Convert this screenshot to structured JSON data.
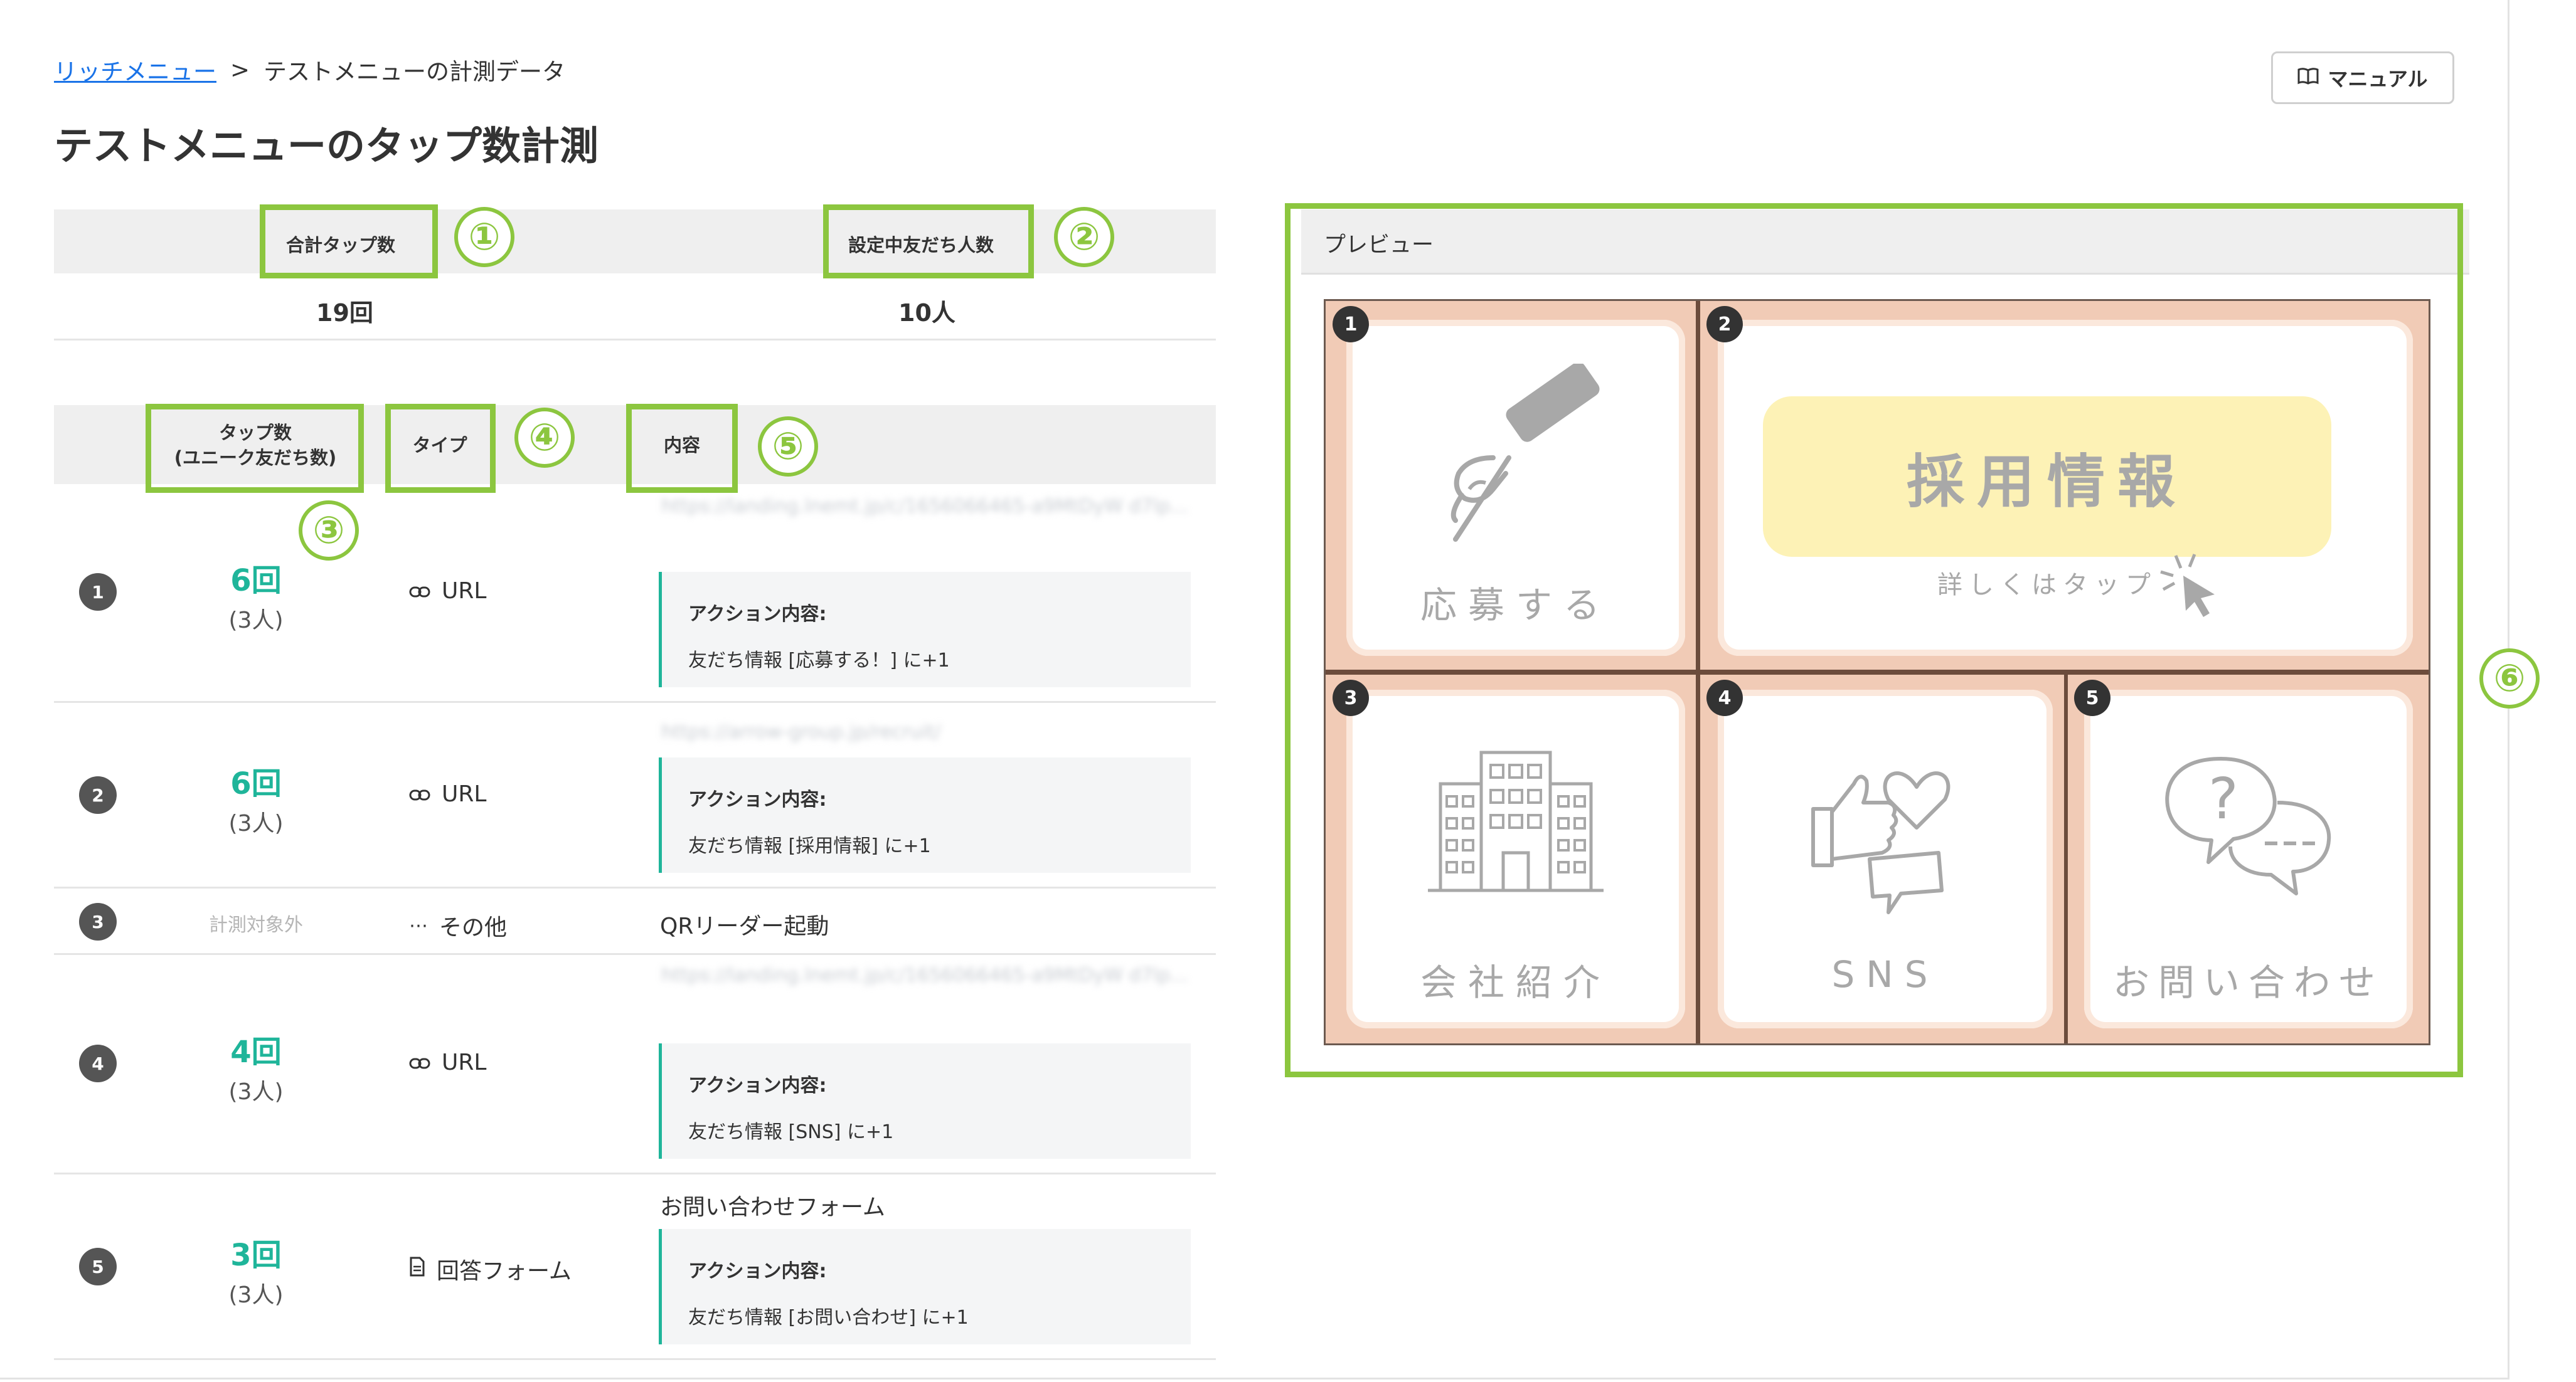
{
  "breadcrumb": {
    "parent": "リッチメニュー",
    "separator": ">",
    "current": "テストメニューの計測データ"
  },
  "page_title": "テストメニューのタップ数計測",
  "manual_button": "マニュアル",
  "summary": {
    "total_taps_label": "合計タップ数",
    "total_taps_value": "19回",
    "friends_label": "設定中友だち人数",
    "friends_value": "10人"
  },
  "table": {
    "headers": {
      "taps_line1": "タップ数",
      "taps_line2": "(ユニーク友だち数)",
      "type": "タイプ",
      "content": "内容"
    },
    "rows": [
      {
        "num": "1",
        "count": "6回",
        "people": "(3人)",
        "type": "URL",
        "url": "https://landing.lnemt.jp/c/1656066465-a9MtDyW d7lp...",
        "action_title": "アクション内容:",
        "action_detail": "友だち情報 [応募する！] に+1"
      },
      {
        "num": "2",
        "count": "6回",
        "people": "(3人)",
        "type": "URL",
        "url": "https://arrow-group.jp/recruit/",
        "action_title": "アクション内容:",
        "action_detail": "友だち情報 [採用情報] に+1"
      },
      {
        "num": "3",
        "count": "計測対象外",
        "type": "その他",
        "content": "QRリーダー起動"
      },
      {
        "num": "4",
        "count": "4回",
        "people": "(3人)",
        "type": "URL",
        "url": "https://landing.lnemt.jp/c/1656066465-a9MtDyW d7lp...",
        "action_title": "アクション内容:",
        "action_detail": "友だち情報 [SNS] に+1"
      },
      {
        "num": "5",
        "count": "3回",
        "people": "(3人)",
        "type": "回答フォーム",
        "content": "お問い合わせフォーム",
        "action_title": "アクション内容:",
        "action_detail": "友だち情報 [お問い合わせ] に+1"
      }
    ]
  },
  "annotations": [
    "①",
    "②",
    "③",
    "④",
    "⑤",
    "⑥"
  ],
  "preview": {
    "title": "プレビュー",
    "cells": [
      {
        "num": "1",
        "label": "応募する"
      },
      {
        "num": "2",
        "label": "採用情報",
        "sub": "詳しくはタップ"
      },
      {
        "num": "3",
        "label": "会社紹介"
      },
      {
        "num": "4",
        "label": "SNS"
      },
      {
        "num": "5",
        "label": "お問い合わせ"
      }
    ]
  },
  "colors": {
    "accent_green": "#1fb59a",
    "annotation_green": "#8cc63f",
    "menu_peach": "#f1cbb6",
    "recruit_yellow": "#fdf2b6"
  }
}
